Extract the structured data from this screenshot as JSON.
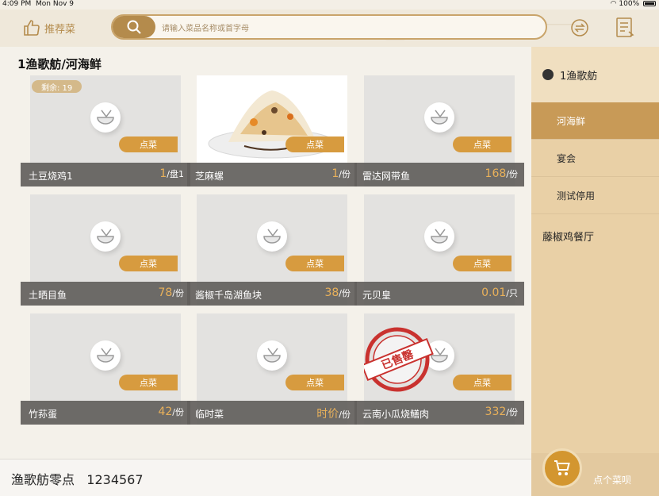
{
  "status": {
    "time": "4:09 PM",
    "date": "Mon Nov 9",
    "battery": "100%"
  },
  "header": {
    "recommend_label": "推荐菜",
    "search_placeholder": "请输入菜品名称或首字母"
  },
  "breadcrumb": "1渔歌舫/河海鲜",
  "dishes": [
    {
      "name": "土豆烧鸡1",
      "price": "1",
      "unit": "/盘1",
      "order_label": "点菜",
      "stock_label": "剩余: 19"
    },
    {
      "name": "芝麻螺",
      "price": "1",
      "unit": "/份",
      "order_label": "点菜"
    },
    {
      "name": "雷达网带鱼",
      "price": "168",
      "unit": "/份",
      "order_label": "点菜"
    },
    {
      "name": "土晒目鱼",
      "price": "78",
      "unit": "/份",
      "order_label": "点菜"
    },
    {
      "name": "酱椒千岛湖鱼块",
      "price": "38",
      "unit": "/份",
      "order_label": "点菜"
    },
    {
      "name": "元贝皇",
      "price": "0.01",
      "unit": "/只",
      "order_label": "点菜"
    },
    {
      "name": "竹荪蛋",
      "price": "42",
      "unit": "/份",
      "order_label": "点菜"
    },
    {
      "name": "临时菜",
      "price": "时价",
      "unit": "/份",
      "order_label": "点菜"
    },
    {
      "name": "云南小瓜烧鳝肉",
      "price": "332",
      "unit": "/份",
      "order_label": "点菜",
      "soldout_label": "已售罄"
    }
  ],
  "sidebar": {
    "restaurant": "1渔歌舫",
    "items": [
      {
        "label": "河海鲜",
        "active": true
      },
      {
        "label": "宴会",
        "active": false
      },
      {
        "label": "测试停用",
        "active": false
      }
    ],
    "group": "藤椒鸡餐厅"
  },
  "footer": {
    "venue": "渔歌舫零点",
    "code": "1234567"
  },
  "cart": {
    "label": "点个菜呗"
  },
  "colors": {
    "accent": "#d79b3f",
    "sidebar": "#e9d0a6",
    "active": "#c89a57"
  }
}
